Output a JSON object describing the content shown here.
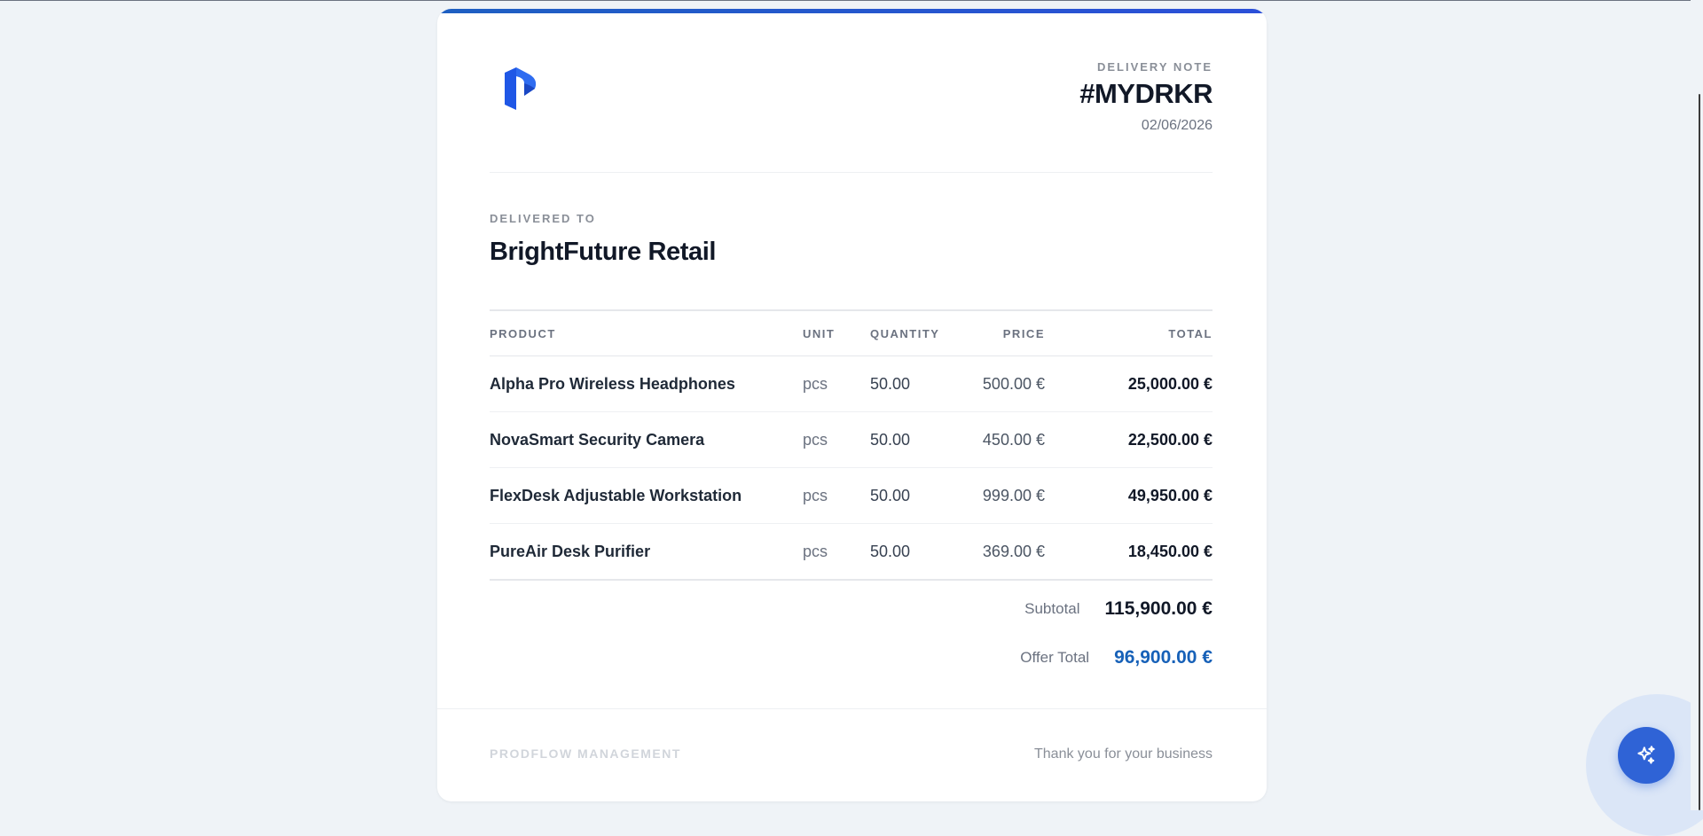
{
  "document": {
    "type_label": "DELIVERY NOTE",
    "number": "#MYDRKR",
    "date": "02/06/2026"
  },
  "recipient": {
    "label": "DELIVERED TO",
    "name": "BrightFuture Retail"
  },
  "table": {
    "headers": {
      "product": "PRODUCT",
      "unit": "UNIT",
      "quantity": "QUANTITY",
      "price": "PRICE",
      "total": "TOTAL"
    },
    "rows": [
      {
        "product": "Alpha Pro Wireless Headphones",
        "unit": "pcs",
        "quantity": "50.00",
        "price": "500.00 €",
        "total": "25,000.00 €"
      },
      {
        "product": "NovaSmart Security Camera",
        "unit": "pcs",
        "quantity": "50.00",
        "price": "450.00 €",
        "total": "22,500.00 €"
      },
      {
        "product": "FlexDesk Adjustable Workstation",
        "unit": "pcs",
        "quantity": "50.00",
        "price": "999.00 €",
        "total": "49,950.00 €"
      },
      {
        "product": "PureAir Desk Purifier",
        "unit": "pcs",
        "quantity": "50.00",
        "price": "369.00 €",
        "total": "18,450.00 €"
      }
    ]
  },
  "summary": {
    "subtotal_label": "Subtotal",
    "subtotal_value": "115,900.00 €",
    "offer_total_label": "Offer Total",
    "offer_total_value": "96,900.00 €"
  },
  "footer": {
    "company": "PRODFLOW MANAGEMENT",
    "thanks": "Thank you for your business"
  },
  "icons": {
    "logo": "brand-logo-icon",
    "fab": "sparkles-icon"
  },
  "colors": {
    "accent": "#1761b8",
    "brand": "#2f63d6",
    "background": "#eff3f7"
  }
}
